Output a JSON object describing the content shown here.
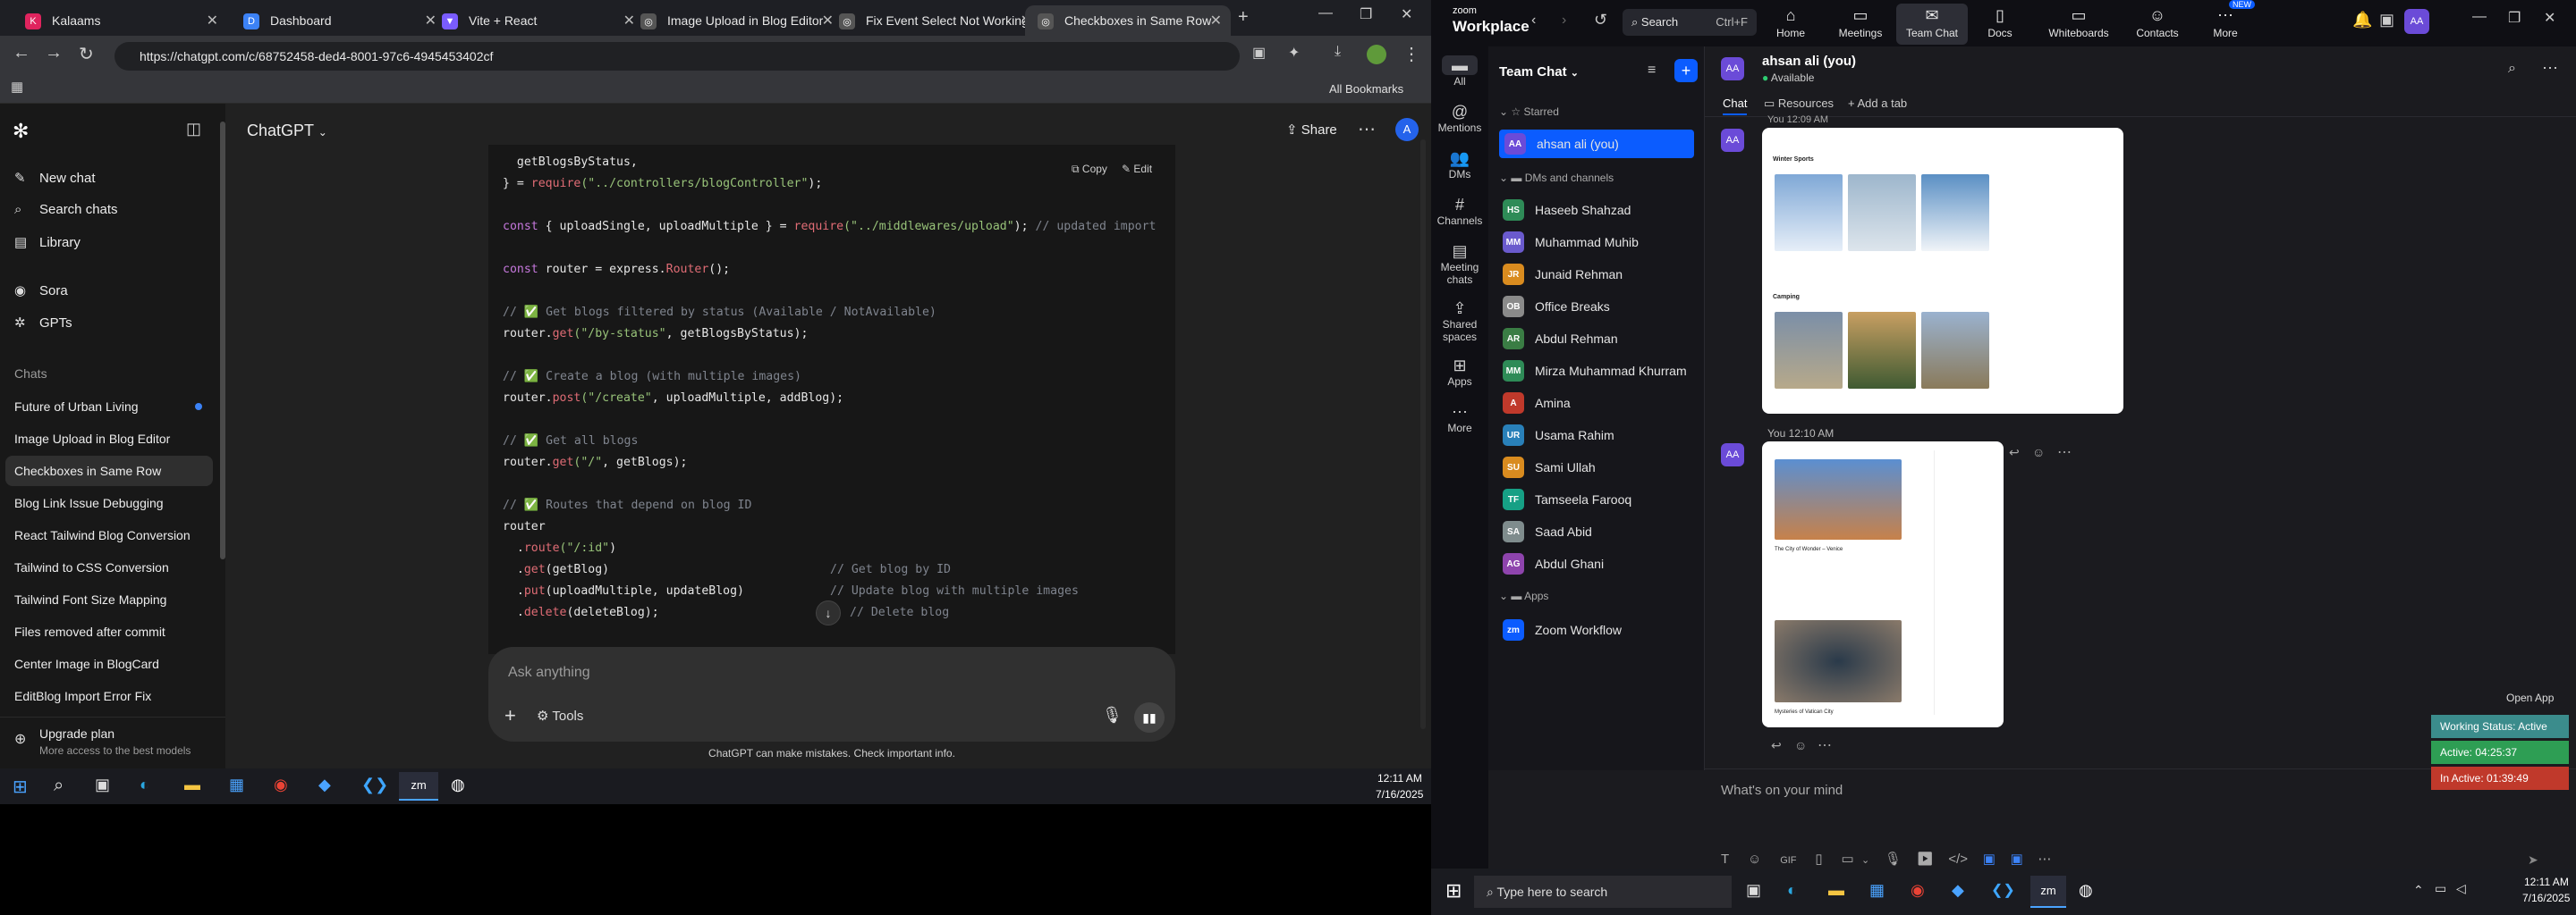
{
  "chrome": {
    "tabs": [
      {
        "title": "Kalaams",
        "color": "#e0245e"
      },
      {
        "title": "Dashboard",
        "color": "#3c82f6"
      },
      {
        "title": "Vite + React",
        "color": "#7a5cff"
      },
      {
        "title": "Image Upload in Blog Editor",
        "color": "#555"
      },
      {
        "title": "Fix Event Select Not Working",
        "color": "#555"
      },
      {
        "title": "Checkboxes in Same Row",
        "color": "#555"
      }
    ],
    "url": "https://chatgpt.com/c/68752458-ded4-8001-97c6-4945453402cf",
    "all_bookmarks": "All Bookmarks"
  },
  "gpt": {
    "model": "ChatGPT",
    "share": "Share",
    "avatar": "A",
    "new_chat": "New chat",
    "search_chats": "Search chats",
    "library": "Library",
    "sora": "Sora",
    "gpts": "GPTs",
    "chats_heading": "Chats",
    "chats": [
      "Future of Urban Living",
      "Image Upload in Blog Editor",
      "Checkboxes in Same Row",
      "Blog Link Issue Debugging",
      "React Tailwind Blog Conversion",
      "Tailwind to CSS Conversion",
      "Tailwind Font Size Mapping",
      "Files removed after commit",
      "Center Image in BlogCard",
      "EditBlog Import Error Fix"
    ],
    "upgrade_title": "Upgrade plan",
    "upgrade_sub": "More access to the best models",
    "copy": "Copy",
    "edit": "Edit",
    "ask_placeholder": "Ask anything",
    "tools": "Tools",
    "disclaimer": "ChatGPT can make mistakes. Check important info.",
    "code": {
      "l1": "  getBlogsByStatus,",
      "l2a": "} = ",
      "l2b": "require",
      "l2c": "(\"../controllers/blogController\"",
      "l2d": ");",
      "l3a": "const",
      "l3b": " { uploadSingle, uploadMultiple } = ",
      "l3c": "require",
      "l3d": "(\"../middlewares/upload\"",
      "l3e": "); ",
      "l3f": "// updated import",
      "l4a": "const",
      "l4b": " router = express.",
      "l4c": "Router",
      "l4d": "();",
      "c1": "// ✅ Get blogs filtered by status (Available / NotAvailable)",
      "l5a": "router.",
      "l5b": "get",
      "l5c": "(\"/by-status\"",
      "l5d": ", getBlogsByStatus);",
      "c2": "// ✅ Create a blog (with multiple images)",
      "l6a": "router.",
      "l6b": "post",
      "l6c": "(\"/create\"",
      "l6d": ", uploadMultiple, addBlog);",
      "c3": "// ✅ Get all blogs",
      "l7a": "router.",
      "l7b": "get",
      "l7c": "(\"/\"",
      "l7d": ", getBlogs);",
      "c4": "// ✅ Routes that depend on blog ID",
      "l8": "router",
      "l9a": "  .",
      "l9b": "route",
      "l9c": "(\"/:id\"",
      "l9d": ")",
      "l10a": "  .",
      "l10b": "get",
      "l10c": "(getBlog)",
      "l10d": "// Get blog by ID",
      "l11a": "  .",
      "l11b": "put",
      "l11c": "(uploadMultiple, updateBlog)",
      "l11d": "// Update blog with multiple images",
      "l12a": "  .",
      "l12b": "delete",
      "l12c": "(deleteBlog);",
      "l12d": "// Delete blog"
    }
  },
  "taskbar_left": {
    "time": "12:11 AM",
    "date": "7/16/2025"
  },
  "zoom": {
    "brand_top": "zoom",
    "brand": "Workplace",
    "search": "Search",
    "search_shortcut": "Ctrl+F",
    "tabs": [
      {
        "label": "Home",
        "icon": "home-icon",
        "glyph": "⌂"
      },
      {
        "label": "Meetings",
        "icon": "camera-icon",
        "glyph": "▭"
      },
      {
        "label": "Team Chat",
        "icon": "chat-icon",
        "glyph": "✉"
      },
      {
        "label": "Docs",
        "icon": "doc-icon",
        "glyph": "▯"
      },
      {
        "label": "Whiteboards",
        "icon": "whiteboard-icon",
        "glyph": "▭"
      },
      {
        "label": "Contacts",
        "icon": "contacts-icon",
        "glyph": "☺"
      },
      {
        "label": "More",
        "icon": "more-icon",
        "glyph": "⋯",
        "badge": "NEW"
      }
    ],
    "user_initials": "AA",
    "rail": [
      "All",
      "Mentions",
      "DMs",
      "Channels",
      "Meeting chats",
      "Shared spaces",
      "Apps",
      "More"
    ],
    "list_title": "Team Chat",
    "starred": "Starred",
    "me": "ahsan ali (you)",
    "dms_heading": "DMs and channels",
    "people": [
      {
        "name": "Haseeb Shahzad",
        "initials": "HS",
        "color": "#2e8b57"
      },
      {
        "name": "Muhammad Muhib",
        "initials": "MM",
        "color": "#6a5acd"
      },
      {
        "name": "Junaid Rehman",
        "initials": "JR",
        "color": "#d98b1f"
      },
      {
        "name": "Office Breaks",
        "initials": "OB",
        "color": "#8a8a8a"
      },
      {
        "name": "Abdul Rehman",
        "initials": "AR",
        "color": "#3a7d44"
      },
      {
        "name": "Mirza Muhammad Khurram",
        "initials": "MM",
        "color": "#2e8b57"
      },
      {
        "name": "Amina",
        "initials": "A",
        "color": "#c0392b"
      },
      {
        "name": "Usama Rahim",
        "initials": "UR",
        "color": "#2980b9"
      },
      {
        "name": "Sami Ullah",
        "initials": "SU",
        "color": "#d98b1f"
      },
      {
        "name": "Tamseela Farooq",
        "initials": "TF",
        "color": "#16a085"
      },
      {
        "name": "Saad Abid",
        "initials": "SA",
        "color": "#7f8c8d"
      },
      {
        "name": "Abdul Ghani",
        "initials": "AG",
        "color": "#8e44ad"
      }
    ],
    "apps_heading": "Apps",
    "app": "Zoom Workflow",
    "chat_name": "ahsan ali (you)",
    "chat_status": "Available",
    "tab_chat": "Chat",
    "tab_resources": "Resources",
    "tab_add": "Add a tab",
    "msg1_time": "You 12:09 AM",
    "msg2_time": "You 12:10 AM",
    "card1_heading1": "Winter Sports",
    "card1_heading2": "Camping",
    "card2_caption": "The City of Wonder – Venice",
    "card2_caption2": "Mysteries of Vatican City",
    "open_app": "Open App",
    "working_status": "Working Status: Active",
    "active": "Active: 04:25:37",
    "inactive": "In Active: 01:39:49",
    "composer_placeholder": "What's on your mind",
    "taskbar_search": "Type here to search",
    "time": "12:11 AM",
    "date": "7/16/2025"
  }
}
